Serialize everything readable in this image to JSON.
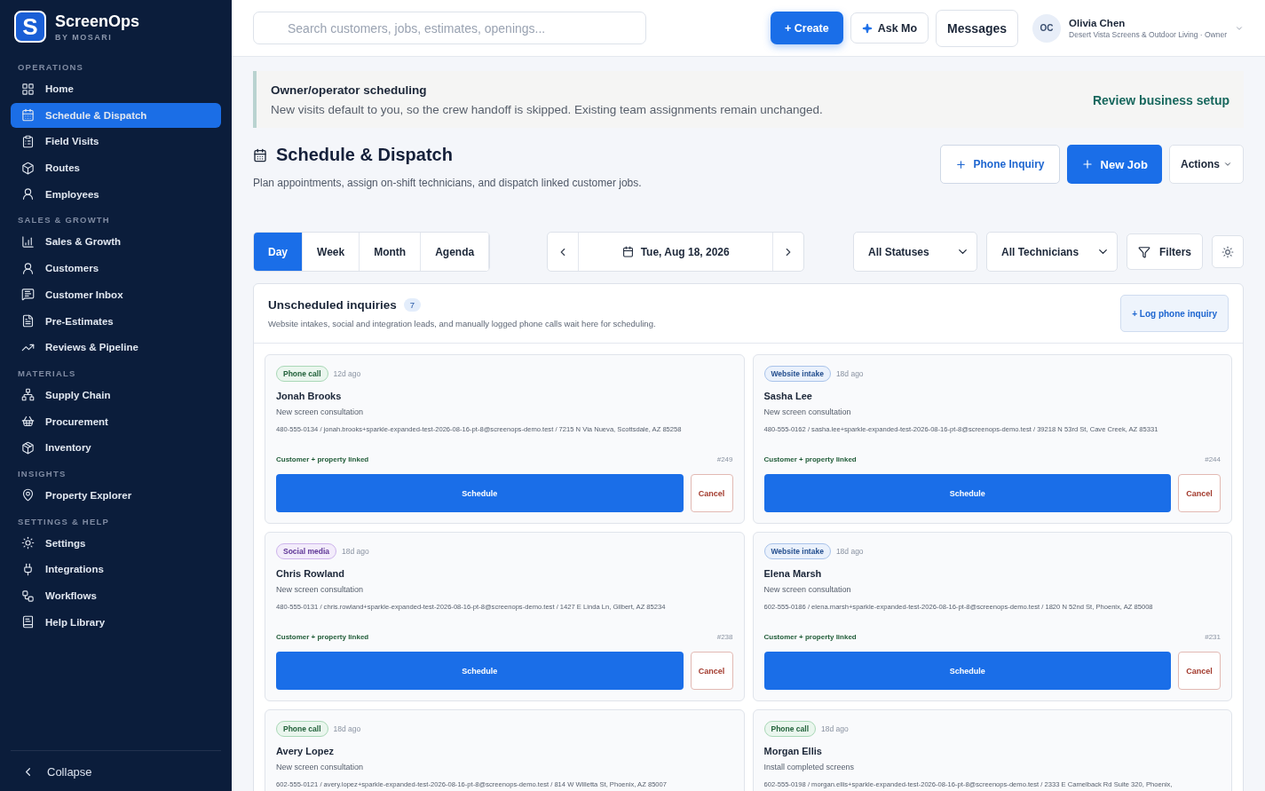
{
  "brand": {
    "logo_letter": "S",
    "name": "ScreenOps",
    "tagline": "BY MOSARI"
  },
  "sidebar": {
    "sections": [
      {
        "title": "OPERATIONS",
        "items": [
          {
            "label": "Home",
            "selected": false
          },
          {
            "label": "Schedule & Dispatch",
            "selected": true
          },
          {
            "label": "Field Visits",
            "selected": false
          },
          {
            "label": "Routes",
            "selected": false
          },
          {
            "label": "Employees",
            "selected": false
          }
        ]
      },
      {
        "title": "SALES & GROWTH",
        "items": [
          {
            "label": "Sales & Growth",
            "selected": false
          },
          {
            "label": "Customers",
            "selected": false
          },
          {
            "label": "Customer Inbox",
            "selected": false
          },
          {
            "label": "Pre-Estimates",
            "selected": false
          },
          {
            "label": "Reviews & Pipeline",
            "selected": false
          }
        ]
      },
      {
        "title": "MATERIALS",
        "items": [
          {
            "label": "Supply Chain",
            "selected": false
          },
          {
            "label": "Procurement",
            "selected": false
          },
          {
            "label": "Inventory",
            "selected": false
          }
        ]
      },
      {
        "title": "INSIGHTS",
        "items": [
          {
            "label": "Property Explorer",
            "selected": false
          }
        ]
      },
      {
        "title": "SETTINGS & HELP",
        "items": [
          {
            "label": "Settings",
            "selected": false
          },
          {
            "label": "Integrations",
            "selected": false
          },
          {
            "label": "Workflows",
            "selected": false
          },
          {
            "label": "Help Library",
            "selected": false
          }
        ]
      }
    ],
    "collapse": "Collapse"
  },
  "header": {
    "search": {
      "placeholder": "Search customers, jobs, estimates, openings..."
    },
    "create": "+ Create",
    "ask": "Ask Mo",
    "messages": "Messages",
    "user": {
      "initials": "OC",
      "name": "Olivia Chen",
      "org": "Desert Vista Screens & Outdoor Living · Owner"
    }
  },
  "banner": {
    "title": "Owner/operator scheduling",
    "text": "New visits default to you, so the crew handoff is skipped. Existing team assignments remain unchanged.",
    "link": "Review business setup"
  },
  "page": {
    "title": "Schedule & Dispatch",
    "subtitle": "Plan appointments, assign on-shift technicians, and dispatch linked customer jobs.",
    "actions": {
      "phone": "Phone Inquiry",
      "new_job": "New Job",
      "more": "Actions"
    }
  },
  "toolbar": {
    "views": [
      {
        "label": "Day",
        "selected": true
      },
      {
        "label": "Week",
        "selected": false
      },
      {
        "label": "Month",
        "selected": false
      },
      {
        "label": "Agenda",
        "selected": false
      }
    ],
    "date": "Tue, Aug 18, 2026",
    "status_filter": "All Statuses",
    "technician_filter": "All Technicians",
    "filters": "Filters"
  },
  "inquiries": {
    "title": "Unscheduled inquiries",
    "count": "7",
    "description": "Website intakes, social and integration leads, and manually logged phone calls wait here for scheduling.",
    "log_button": "+ Log phone inquiry",
    "cards": [
      {
        "kind": "phone",
        "tag": "Phone call",
        "age": "12d ago",
        "name": "Jonah Brooks",
        "service": "New screen consultation",
        "contact": "480-555-0134 / jonah.brooks+sparkle-expanded-test-2026-08-16-pt-8@screenops-demo.test / 7215 N Via Nueva, Scottsdale, AZ 85258",
        "linked": "Customer + property linked",
        "ref": "#249",
        "schedule": "Schedule",
        "cancel": "Cancel"
      },
      {
        "kind": "website",
        "tag": "Website intake",
        "age": "18d ago",
        "name": "Sasha Lee",
        "service": "New screen consultation",
        "contact": "480-555-0162 / sasha.lee+sparkle-expanded-test-2026-08-16-pt-8@screenops-demo.test / 39218 N 53rd St, Cave Creek, AZ 85331",
        "linked": "Customer + property linked",
        "ref": "#244",
        "schedule": "Schedule",
        "cancel": "Cancel"
      },
      {
        "kind": "social",
        "tag": "Social media",
        "age": "18d ago",
        "name": "Chris Rowland",
        "service": "New screen consultation",
        "contact": "480-555-0131 / chris.rowland+sparkle-expanded-test-2026-08-16-pt-8@screenops-demo.test / 1427 E Linda Ln, Gilbert, AZ 85234",
        "linked": "Customer + property linked",
        "ref": "#238",
        "schedule": "Schedule",
        "cancel": "Cancel"
      },
      {
        "kind": "website",
        "tag": "Website intake",
        "age": "18d ago",
        "name": "Elena Marsh",
        "service": "New screen consultation",
        "contact": "602-555-0186 / elena.marsh+sparkle-expanded-test-2026-08-16-pt-8@screenops-demo.test / 1820 N 52nd St, Phoenix, AZ 85008",
        "linked": "Customer + property linked",
        "ref": "#231",
        "schedule": "Schedule",
        "cancel": "Cancel"
      },
      {
        "kind": "phone",
        "tag": "Phone call",
        "age": "18d ago",
        "name": "Avery Lopez",
        "service": "New screen consultation",
        "contact": "602-555-0121 / avery.lopez+sparkle-expanded-test-2026-08-16-pt-8@screenops-demo.test / 814 W Willetta St, Phoenix, AZ 85007"
      },
      {
        "kind": "phone",
        "tag": "Phone call",
        "age": "18d ago",
        "name": "Morgan Ellis",
        "service": "Install completed screens",
        "contact": "602-555-0198 / morgan.ellis+sparkle-expanded-test-2026-08-16-pt-8@screenops-demo.test / 2333 E Camelback Rd Suite 320, Phoenix,"
      }
    ]
  }
}
